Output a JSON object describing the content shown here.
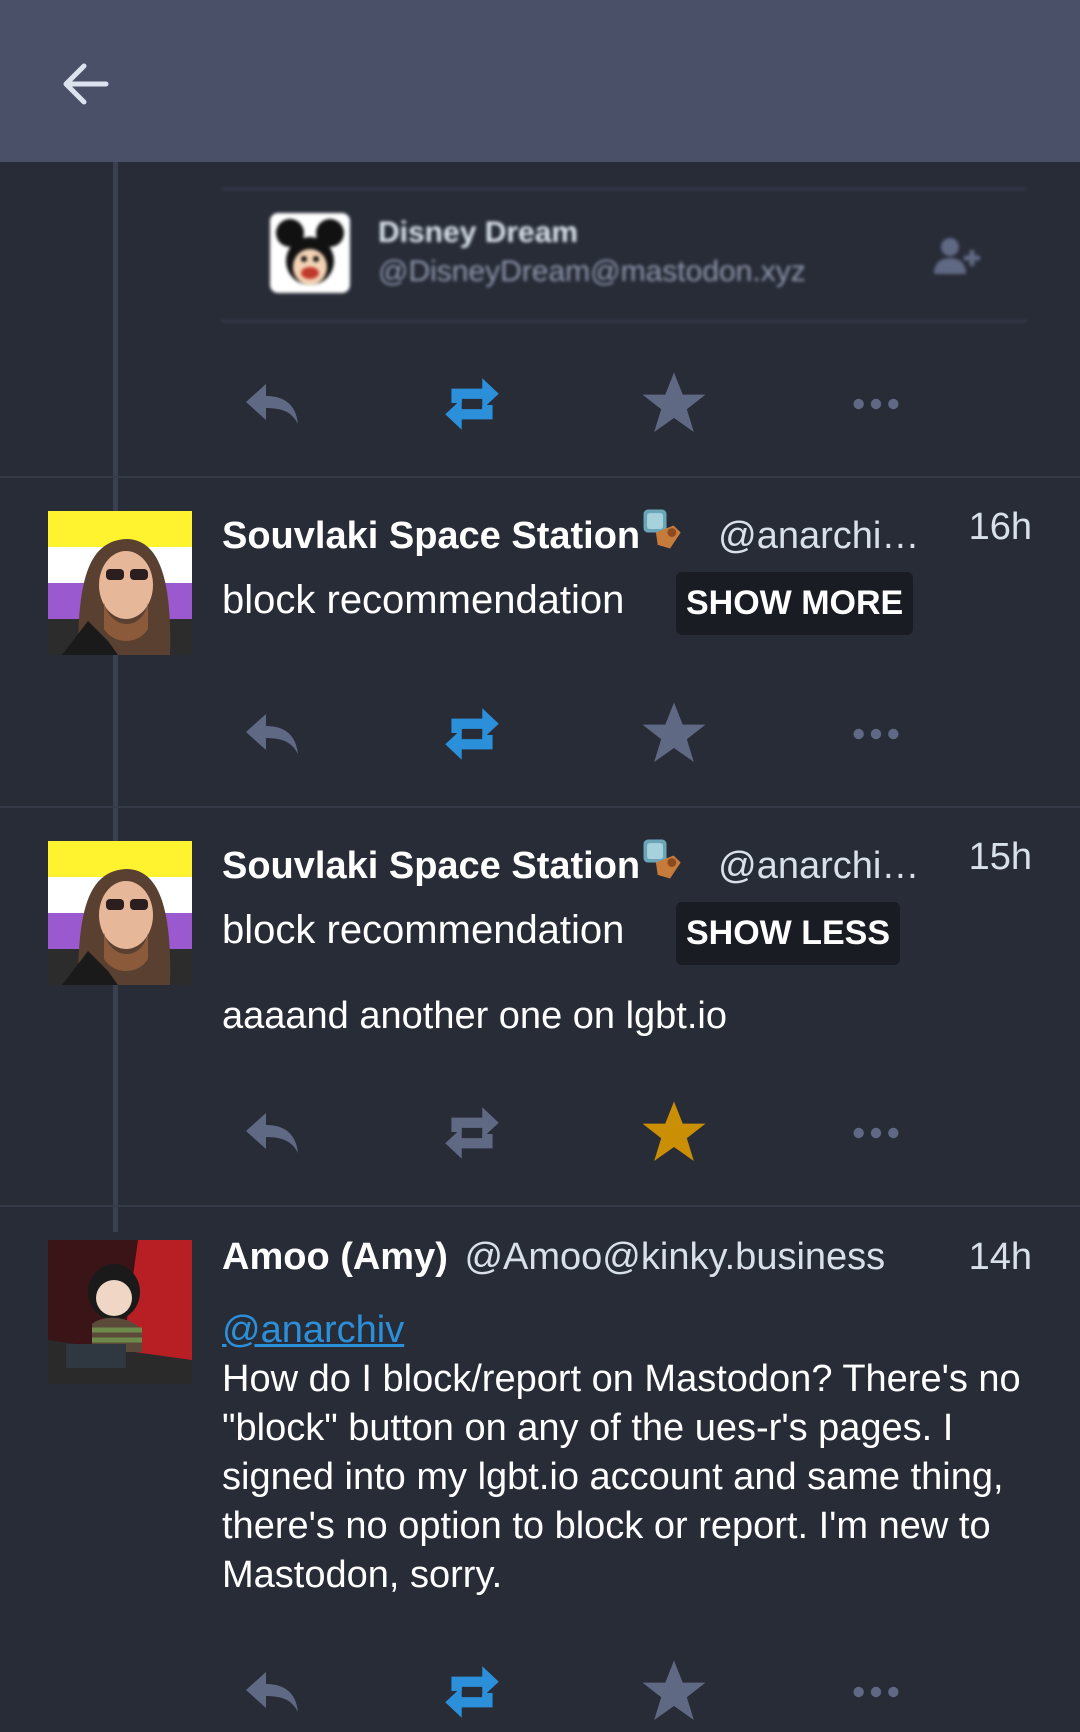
{
  "appbar": {
    "back_icon": "arrow-left-icon"
  },
  "colors": {
    "background": "#282c37",
    "appbar": "#4a5068",
    "action_gray": "#606984",
    "boost_active": "#2b90d9",
    "favourite_active": "#ca8f04",
    "link": "#2b90d9"
  },
  "account_card": {
    "name": "Disney Dream",
    "handle": "@DisneyDream@mastodon.xyz"
  },
  "posts": [
    {
      "display_name": "Souvlaki Space Station",
      "handle": "@anarchi…",
      "time": "16h",
      "spoiler_text": "block recommendation",
      "toggle_label": "SHOW MORE",
      "boost_active": true,
      "favourite_active": false
    },
    {
      "display_name": "Souvlaki Space Station",
      "handle": "@anarchi…",
      "time": "15h",
      "spoiler_text": "block recommendation",
      "toggle_label": "SHOW LESS",
      "content": "aaaand another one on lgbt.io",
      "boost_active": false,
      "favourite_active": true
    },
    {
      "display_name": "Amoo (Amy)",
      "handle": "@Amoo@kinky.business",
      "time": "14h",
      "mention": "@anarchiv",
      "content": "How do I block/report on Mastodon? There's no \"block\" button on any of the ues-r's pages. I signed into my lgbt.io account and same thing, there's no option to block or report. I'm new to Mastodon, sorry.",
      "boost_active": true,
      "favourite_active": false
    }
  ]
}
